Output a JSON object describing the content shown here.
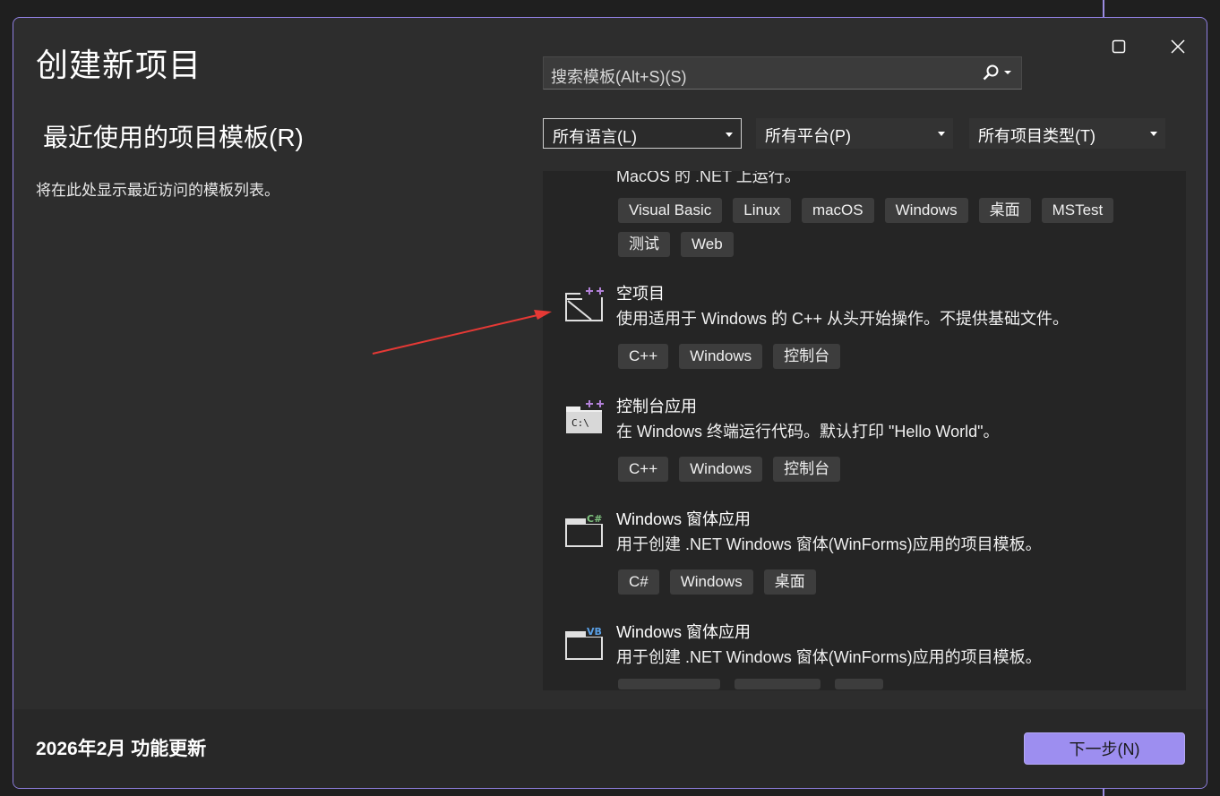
{
  "dialog": {
    "title": "创建新项目",
    "recent_heading": "最近使用的项目模板(R)",
    "recent_desc": "将在此处显示最近访问的模板列表。",
    "footer_notice": "2026年2月 功能更新",
    "next_label": "下一步(N)"
  },
  "search": {
    "placeholder": "搜索模板(Alt+S)(S)"
  },
  "filters": [
    {
      "label": "所有语言(L)"
    },
    {
      "label": "所有平台(P)"
    },
    {
      "label": "所有项目类型(T)"
    }
  ],
  "list": {
    "cut_text": "MacOS 的 .NET 上运行。",
    "top_tags": [
      "Visual Basic",
      "Linux",
      "macOS",
      "Windows",
      "桌面",
      "MSTest",
      "测试",
      "Web"
    ],
    "items": [
      {
        "name": "空项目",
        "desc": "使用适用于 Windows 的 C++ 从头开始操作。不提供基础文件。",
        "tags": [
          "C++",
          "Windows",
          "控制台"
        ],
        "icon": "empty-project-icon",
        "badge": "++"
      },
      {
        "name": "控制台应用",
        "desc": "在 Windows 终端运行代码。默认打印 \"Hello World\"。",
        "tags": [
          "C++",
          "Windows",
          "控制台"
        ],
        "icon": "console-app-icon",
        "badge": "++"
      },
      {
        "name": "Windows 窗体应用",
        "desc": "用于创建 .NET Windows 窗体(WinForms)应用的项目模板。",
        "tags": [
          "C#",
          "Windows",
          "桌面"
        ],
        "icon": "winforms-csharp-icon",
        "badge": "C#"
      },
      {
        "name": "Windows 窗体应用",
        "desc": "用于创建 .NET Windows 窗体(WinForms)应用的项目模板。",
        "tags": [],
        "icon": "winforms-vb-icon",
        "badge": "VB"
      }
    ]
  },
  "colors": {
    "accent": "#9d8ef0",
    "border": "#8f7fe0",
    "arrow": "#e53935",
    "cpp_badge": "#b180d7",
    "cs_badge": "#7ec27e",
    "vb_badge": "#5aa0e6"
  }
}
